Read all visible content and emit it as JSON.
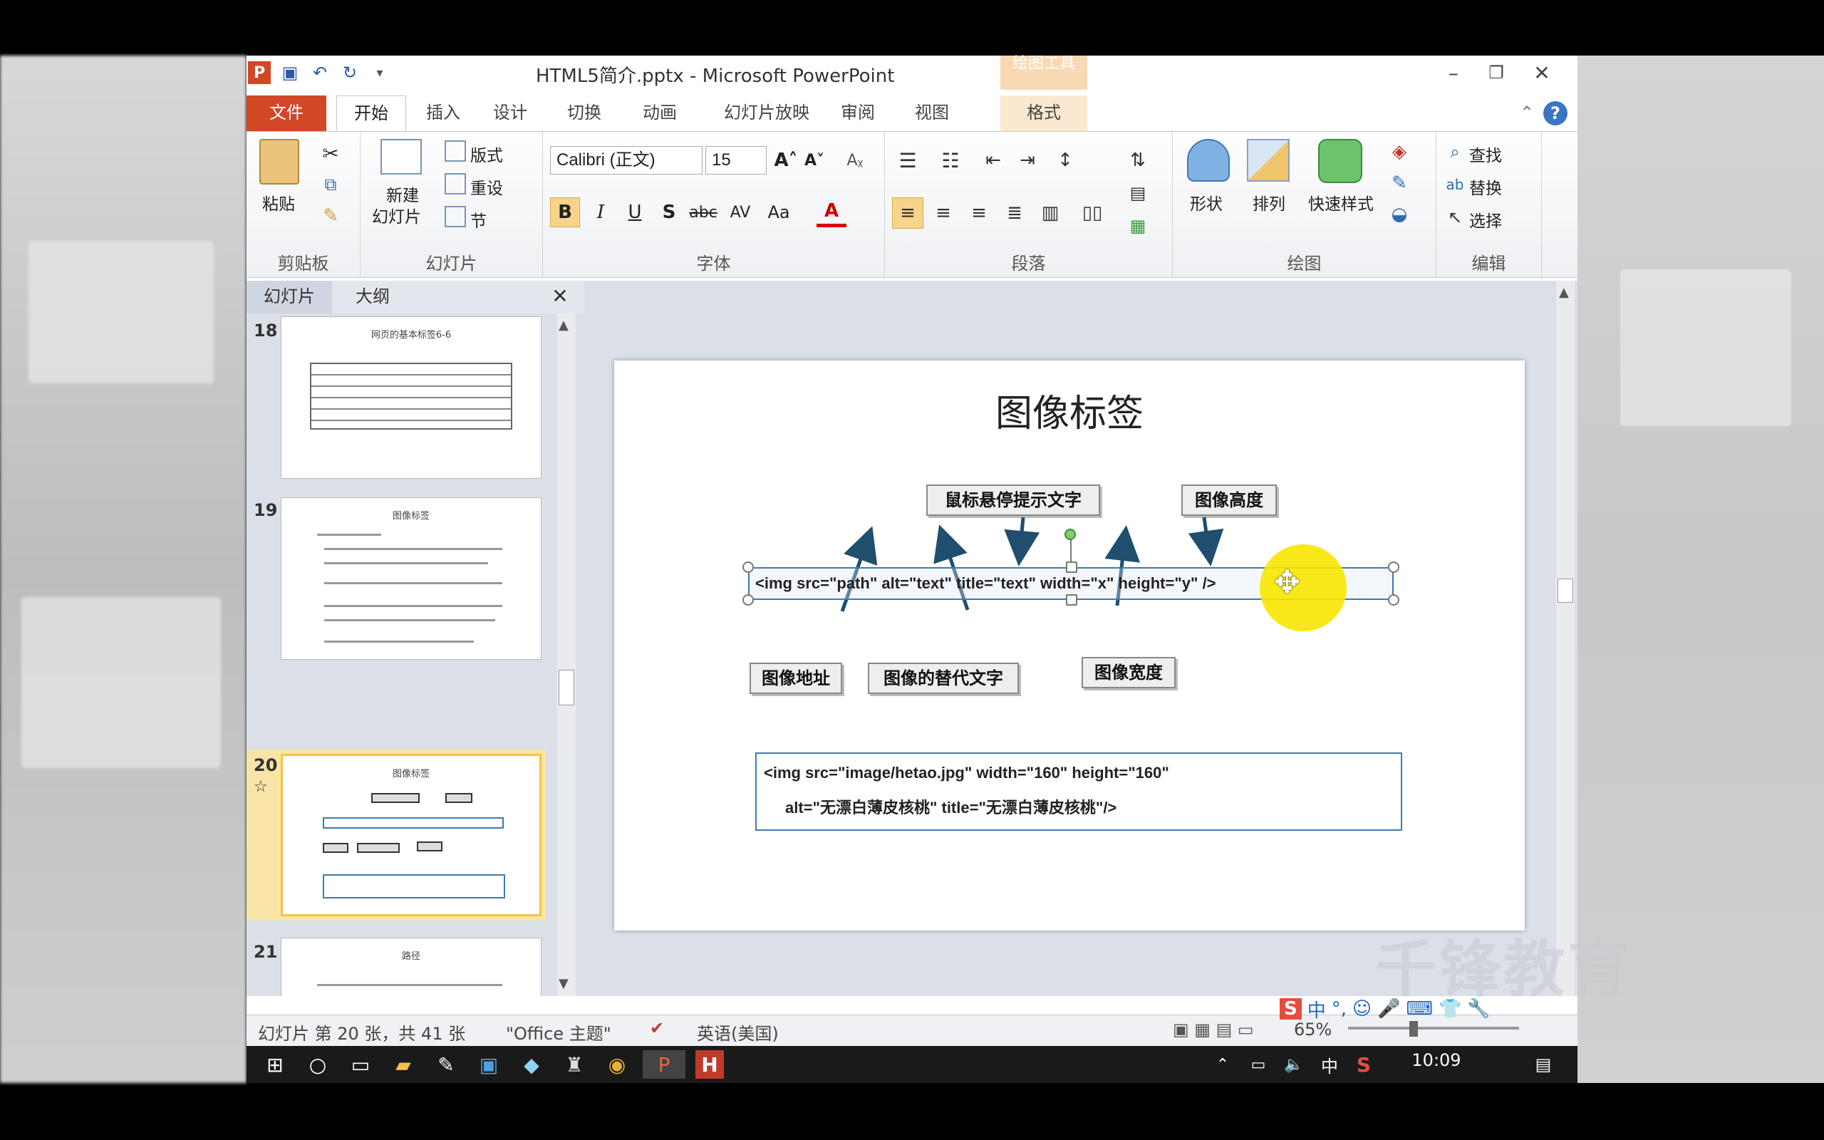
{
  "window": {
    "title": "HTML5简介.pptx - Microsoft PowerPoint",
    "context_tab_group": "绘图工具"
  },
  "tabs": [
    "文件",
    "开始",
    "插入",
    "设计",
    "切换",
    "动画",
    "幻灯片放映",
    "审阅",
    "视图",
    "格式"
  ],
  "ribbon": {
    "clipboard": {
      "paste": "粘贴",
      "label": "剪贴板"
    },
    "slides": {
      "new_line1": "新建",
      "new_line2": "幻灯片",
      "layout": "版式",
      "reset": "重设",
      "section": "节",
      "label": "幻灯片"
    },
    "font": {
      "name": "Calibri (正文)",
      "size": "15",
      "label": "字体"
    },
    "paragraph": {
      "label": "段落"
    },
    "drawing": {
      "shapes": "形状",
      "arrange": "排列",
      "quick_styles": "快速样式",
      "label": "绘图"
    },
    "editing": {
      "find": "查找",
      "replace": "替换",
      "select": "选择",
      "label": "编辑"
    }
  },
  "pane": {
    "tab_slides": "幻灯片",
    "tab_outline": "大纲"
  },
  "thumbnails": [
    {
      "num": "18",
      "title": "网页的基本标签6-6",
      "star": ""
    },
    {
      "num": "19",
      "title": "图像标签",
      "star": ""
    },
    {
      "num": "20",
      "title": "图像标签",
      "star": "☆"
    },
    {
      "num": "21",
      "title": "路径",
      "star": ""
    }
  ],
  "slide": {
    "title": "图像标签",
    "callouts": {
      "title_hover": "鼠标悬停提示文字",
      "height": "图像高度",
      "src": "图像地址",
      "alt": "图像的替代文字",
      "width": "图像宽度"
    },
    "code_main": "<img src=\"path\" alt=\"text\" title=\"text\" width=\"x\" height=\"y\" />",
    "code_example_line1": "<img src=\"image/hetao.jpg\" width=\"160\" height=\"160\"",
    "code_example_line2": "alt=\"无漂白薄皮核桃\" title=\"无漂白薄皮核桃\"/>"
  },
  "status": {
    "slide_info": "幻灯片 第 20 张，共 41 张",
    "theme": "\"Office 主题\"",
    "language": "英语(美国)",
    "zoom": "65%"
  },
  "taskbar": {
    "time": "10:09",
    "ime": "中"
  },
  "watermark": "千锋教育",
  "colors": {
    "file_tab": "#d24726",
    "accent": "#2b579a",
    "selection": "#f5c24b",
    "cursor_highlight": "#f7e600"
  }
}
